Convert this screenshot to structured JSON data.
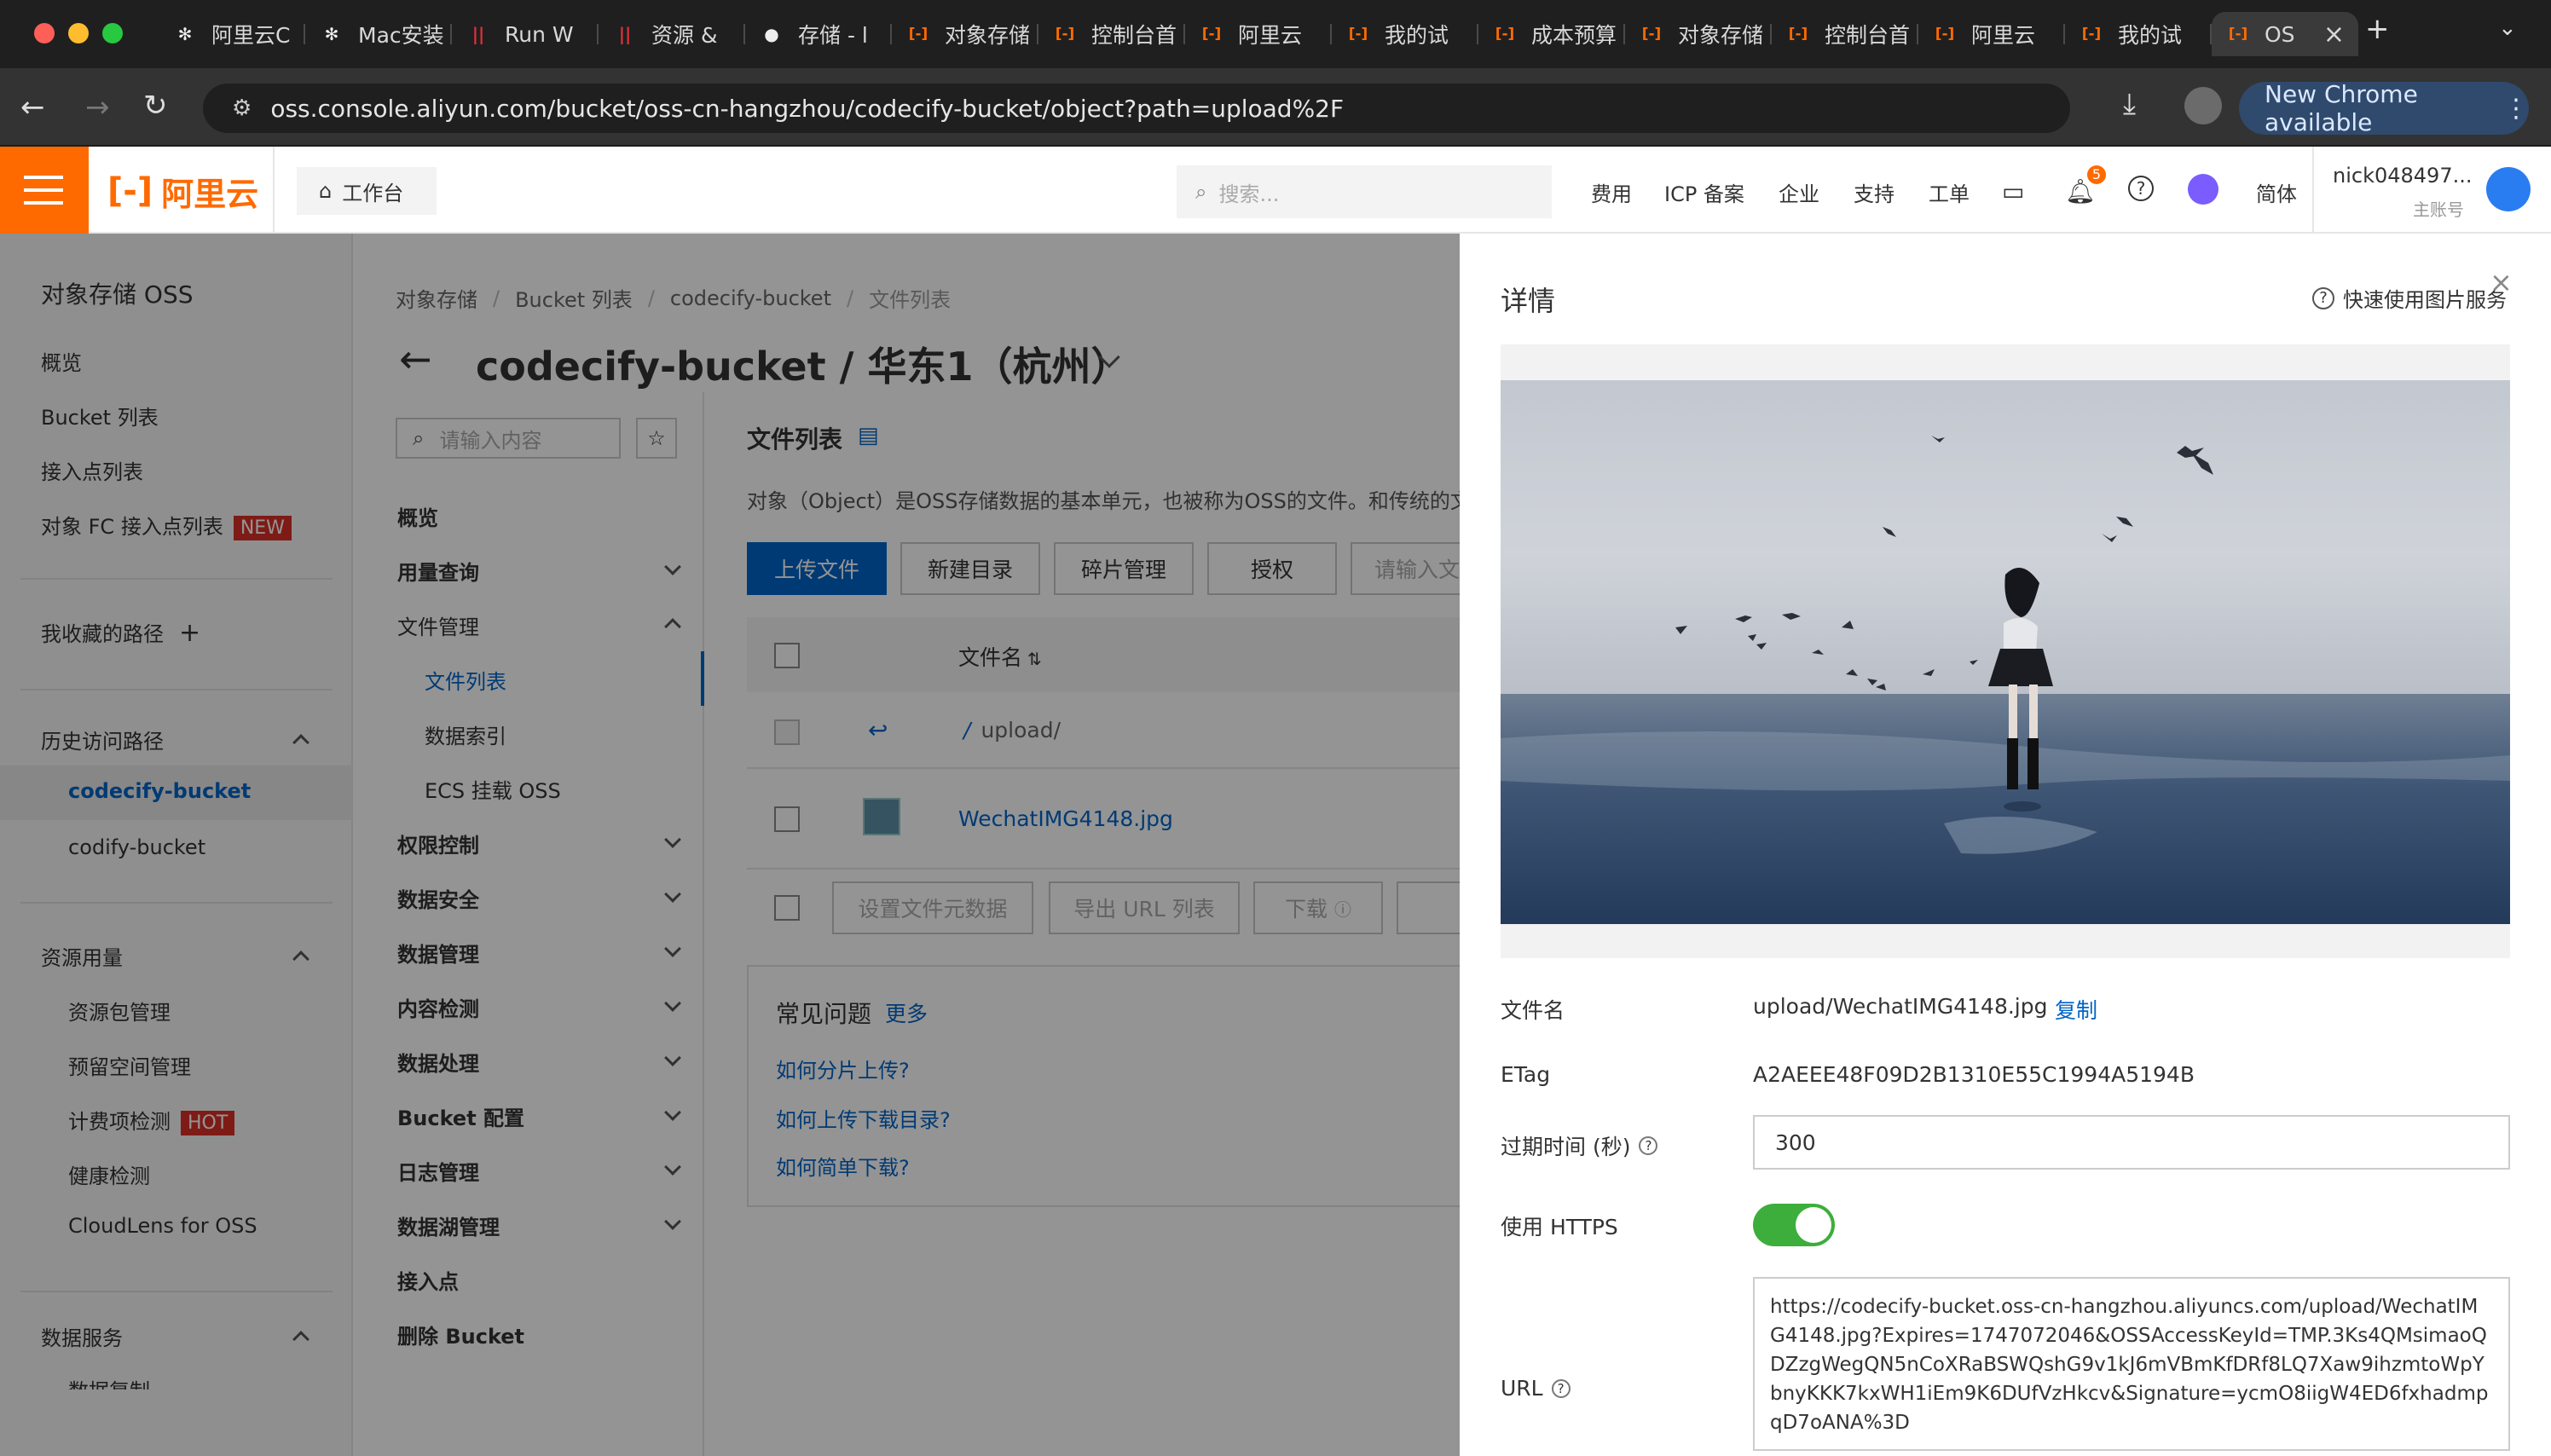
{
  "browser": {
    "tabs": [
      {
        "title": "阿里云C",
        "icon": "openai-icon"
      },
      {
        "title": "Mac安装",
        "icon": "openai-icon"
      },
      {
        "title": "Run W",
        "icon": "bars-icon"
      },
      {
        "title": "资源 &",
        "icon": "bars-icon"
      },
      {
        "title": "存储 - l",
        "icon": "apple-icon"
      },
      {
        "title": "对象存储",
        "icon": "aliyun-icon"
      },
      {
        "title": "控制台首",
        "icon": "aliyun-icon"
      },
      {
        "title": "阿里云",
        "icon": "aliyun-icon"
      },
      {
        "title": "我的试",
        "icon": "aliyun-icon"
      },
      {
        "title": "成本预算",
        "icon": "aliyun-icon"
      },
      {
        "title": "对象存储",
        "icon": "aliyun-icon"
      },
      {
        "title": "控制台首",
        "icon": "aliyun-icon"
      },
      {
        "title": "阿里云",
        "icon": "aliyun-icon"
      },
      {
        "title": "我的试",
        "icon": "aliyun-icon"
      },
      {
        "title": "OS",
        "icon": "aliyun-icon"
      }
    ],
    "url": "oss.console.aliyun.com/bucket/oss-cn-hangzhou/codecify-bucket/object?path=upload%2F",
    "update_button": "New Chrome available"
  },
  "topbar": {
    "logo": "阿里云",
    "workbench": "工作台",
    "search_placeholder": "搜索...",
    "nav": [
      "费用",
      "ICP 备案",
      "企业",
      "支持",
      "工单"
    ],
    "notification_count": "5",
    "language": "简体",
    "user_name": "nick048497...",
    "user_role": "主账号",
    "colors": {
      "brand": "#ff6a00",
      "primary": "#0064c8"
    }
  },
  "sidebar": {
    "title": "对象存储 OSS",
    "items": [
      "概览",
      "Bucket 列表",
      "接入点列表"
    ],
    "fc_item": "对象 FC 接入点列表",
    "fc_badge": "NEW",
    "favorites": "我收藏的路径",
    "history_title": "历史访问路径",
    "history": [
      "codecify-bucket",
      "codify-bucket"
    ],
    "resource_title": "资源用量",
    "resource_items": [
      "资源包管理",
      "预留空间管理"
    ],
    "billing_item": "计费项检测",
    "billing_badge": "HOT",
    "resource_items2": [
      "健康检测",
      "CloudLens for OSS"
    ],
    "data_title": "数据服务",
    "data_items": [
      "数据复制"
    ]
  },
  "breadcrumb": [
    "对象存储",
    "Bucket 列表",
    "codecify-bucket",
    "文件列表"
  ],
  "bucket_title": "codecify-bucket / 华东1（杭州）",
  "bucket_nav": {
    "search_placeholder": "请输入内容",
    "overview": "概览",
    "usage": "用量查询",
    "file_mgmt": "文件管理",
    "file_sub": [
      "文件列表",
      "数据索引",
      "ECS 挂载 OSS"
    ],
    "sections": [
      "权限控制",
      "数据安全",
      "数据管理",
      "内容检测",
      "数据处理",
      "Bucket 配置",
      "日志管理",
      "数据湖管理"
    ],
    "access_point": "接入点",
    "delete": "删除 Bucket"
  },
  "file_list": {
    "title": "文件列表",
    "desc": "对象（Object）是OSS存储数据的基本单元，也被称为OSS的文件。和传统的文",
    "buttons": [
      "上传文件",
      "新建目录",
      "碎片管理",
      "授权"
    ],
    "search_placeholder": "请输入文",
    "col_name": "文件名",
    "rows": [
      "upload/",
      "WechatIMG4148.jpg"
    ],
    "bottom_buttons": [
      "设置文件元数据",
      "导出 URL 列表",
      "下载"
    ],
    "faq_title": "常见问题",
    "faq_more": "更多",
    "faqs": [
      "如何分片上传?",
      "如何上传下载目录?",
      "如何简单下载?"
    ]
  },
  "drawer": {
    "title": "详情",
    "help_link": "快速使用图片服务",
    "filename_label": "文件名",
    "filename": "upload/WechatIMG4148.jpg",
    "copy": "复制",
    "etag_label": "ETag",
    "etag": "A2AEEE48F09D2B1310E55C1994A5194B",
    "expire_label": "过期时间 (秒)",
    "expire_value": "300",
    "https_label": "使用 HTTPS",
    "https_on": true,
    "url_label": "URL",
    "url_value": "https://codecify-bucket.oss-cn-hangzhou.aliyuncs.com/upload/WechatIMG4148.jpg?Expires=1747072046&OSSAccessKeyId=TMP.3Ks4QMsimaoQDZzgWegQN5nCoXRaBSWQshG9v1kJ6mVBmKfDRf8LQ7Xaw9ihzmtoWpYbnyKKK7kxWH1iEm9K6DUfVzHkcv&Signature=ycmO8iigW4ED6fxhadmpqD7oANA%3D"
  }
}
